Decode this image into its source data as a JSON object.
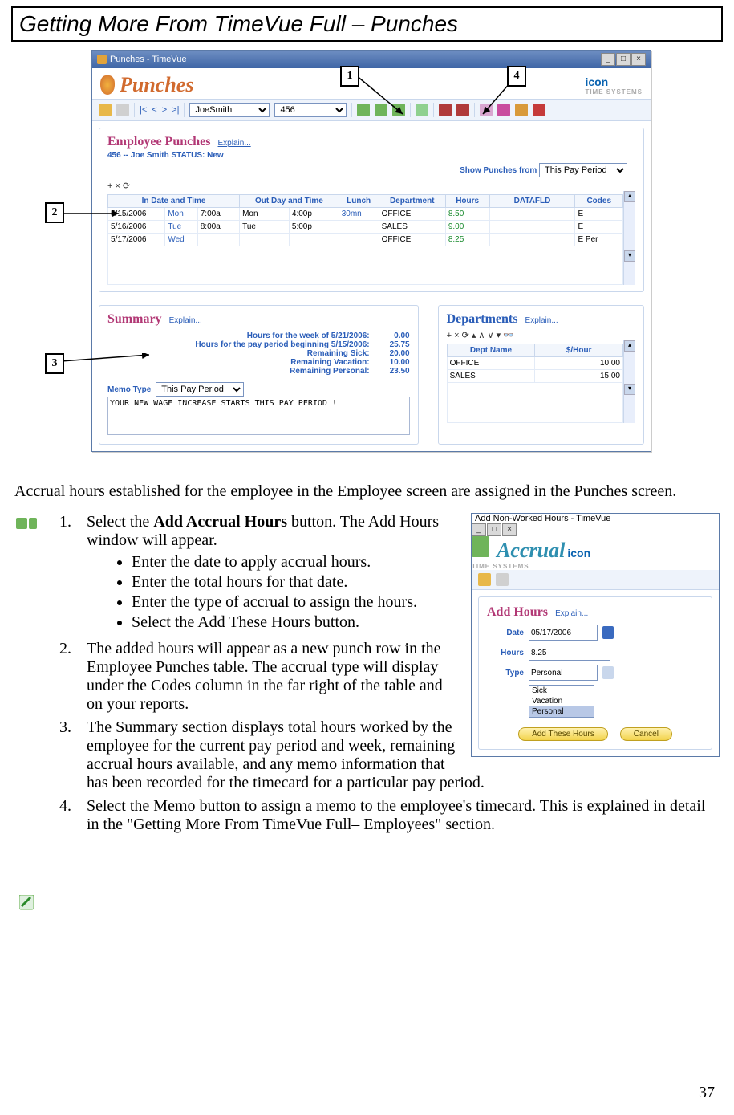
{
  "page": {
    "title": "Getting More From TimeVue Full – Punches",
    "number": "37"
  },
  "callouts": {
    "c1": "1",
    "c2": "2",
    "c3": "3",
    "c4": "4"
  },
  "punches_win": {
    "title": "Punches - TimeVue",
    "brand": "icon",
    "brand_sub": "TIME SYSTEMS",
    "header": "Punches",
    "employee_dd": "JoeSmith",
    "id_dd": "456",
    "section_title": "Employee Punches",
    "explain": "Explain...",
    "status_line": "456 -- Joe Smith    STATUS: New",
    "show_from_label": "Show Punches from",
    "show_from_value": "This Pay Period",
    "cols": {
      "c1": "In Date and Time",
      "c2": "Out Day and Time",
      "c3": "Lunch",
      "c4": "Department",
      "c5": "Hours",
      "c6": "DATAFLD",
      "c7": "Codes"
    },
    "rows": [
      {
        "date": "5/15/2006",
        "in_day": "Mon",
        "in_t": "7:00a",
        "out_day": "Mon",
        "out_t": "4:00p",
        "lunch": "30mn",
        "dept": "OFFICE",
        "hours": "8.50",
        "data": "",
        "codes": "E"
      },
      {
        "date": "5/16/2006",
        "in_day": "Tue",
        "in_t": "8:00a",
        "out_day": "Tue",
        "out_t": "5:00p",
        "lunch": "",
        "dept": "SALES",
        "hours": "9.00",
        "data": "",
        "codes": "E"
      },
      {
        "date": "5/17/2006",
        "in_day": "Wed",
        "in_t": "",
        "out_day": "",
        "out_t": "",
        "lunch": "",
        "dept": "OFFICE",
        "hours": "8.25",
        "data": "",
        "codes": "E Per"
      }
    ],
    "summary": {
      "title": "Summary",
      "week_label": "Hours for the week of 5/21/2006:",
      "week_val": "0.00",
      "period_label": "Hours for the pay period beginning 5/15/2006:",
      "period_val": "25.75",
      "sick_label": "Remaining Sick:",
      "sick_val": "20.00",
      "vac_label": "Remaining Vacation:",
      "vac_val": "10.00",
      "pers_label": "Remaining Personal:",
      "pers_val": "23.50",
      "memo_type_label": "Memo Type",
      "memo_type_value": "This Pay Period",
      "memo_text": "YOUR NEW WAGE INCREASE STARTS THIS PAY PERIOD !"
    },
    "departments": {
      "title": "Departments",
      "col1": "Dept Name",
      "col2": "$/Hour",
      "rows": [
        {
          "name": "OFFICE",
          "rate": "10.00"
        },
        {
          "name": "SALES",
          "rate": "15.00"
        }
      ]
    }
  },
  "intro_text": "Accrual hours established for the employee in the Employee screen are assigned in the Punches screen.",
  "steps": {
    "s1a": "Select the ",
    "s1b": "Add Accrual Hours",
    "s1c": " button. The Add Hours window will appear.",
    "b1": "Enter the date to apply accrual hours.",
    "b2": "Enter the total hours for that date.",
    "b3": "Enter the type of accrual to assign the hours.",
    "b4": "Select the Add These Hours button.",
    "s2": "The added hours will appear as a new punch row in the Employee Punches table. The accrual type will display under the Codes column in the far right of the table and on your reports.",
    "s3": "The Summary section displays total hours worked by the employee for the current pay period and week, remaining accrual hours available, and any memo information that has been recorded for the timecard for a particular pay period.",
    "s4": "Select the Memo button to assign a memo to the employee's timecard.  This is explained in detail in the \"Getting More From TimeVue Full– Employees\" section."
  },
  "numbers": {
    "n1": "1.",
    "n2": "2.",
    "n3": "3.",
    "n4": "4."
  },
  "accrual_win": {
    "title": "Add Non-Worked Hours - TimeVue",
    "header": "Accrual",
    "brand": "icon",
    "brand_sub": "TIME SYSTEMS",
    "section": "Add Hours",
    "explain": "Explain...",
    "date_label": "Date",
    "date_value": "05/17/2006",
    "hours_label": "Hours",
    "hours_value": "8.25",
    "type_label": "Type",
    "type_value": "Personal",
    "opt1": "Sick",
    "opt2": "Vacation",
    "opt3": "Personal",
    "btn_add": "Add These Hours",
    "btn_cancel": "Cancel"
  }
}
